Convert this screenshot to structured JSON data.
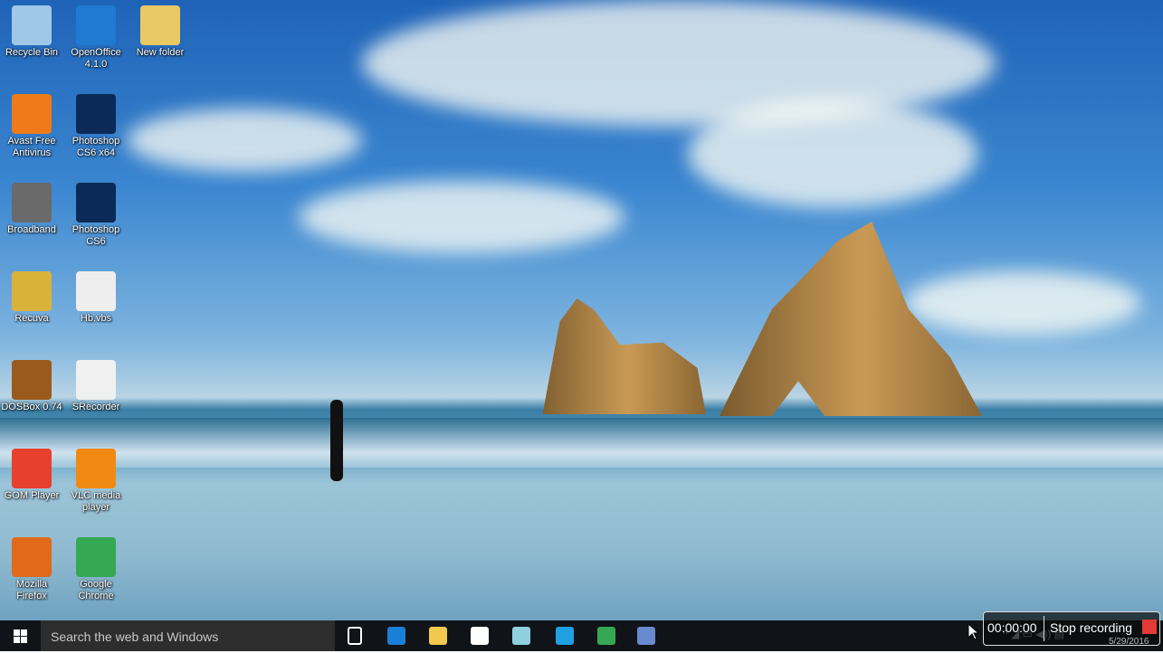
{
  "desktop": {
    "icons": [
      {
        "label": "Recycle Bin",
        "icon": "recycle-bin-icon",
        "color": "#9fc7e8"
      },
      {
        "label": "OpenOffice 4.1.0",
        "icon": "openoffice-icon",
        "color": "#1f7ad0"
      },
      {
        "label": "New folder",
        "icon": "folder-icon",
        "color": "#e8c964"
      },
      {
        "label": "Avast Free Antivirus",
        "icon": "avast-icon",
        "color": "#f07a1a"
      },
      {
        "label": "Photoshop CS6 x64",
        "icon": "photoshop-icon",
        "color": "#0b2a57"
      },
      {
        "label": "Broadband",
        "icon": "evo-icon",
        "color": "#6a6a6a"
      },
      {
        "label": "Photoshop CS6",
        "icon": "photoshop-icon",
        "color": "#0b2a57"
      },
      {
        "label": "Recuva",
        "icon": "recuva-icon",
        "color": "#d9b23a"
      },
      {
        "label": "Hb.vbs",
        "icon": "script-file-icon",
        "color": "#eeeeee"
      },
      {
        "label": "DOSBox 0.74",
        "icon": "dosbox-icon",
        "color": "#9a5a1e"
      },
      {
        "label": "SRecorder",
        "icon": "srecorder-icon",
        "color": "#f0f0f0"
      },
      {
        "label": "GOM Player",
        "icon": "gom-player-icon",
        "color": "#e8402e"
      },
      {
        "label": "VLC media player",
        "icon": "vlc-icon",
        "color": "#f08a12"
      },
      {
        "label": "Mozilla Firefox",
        "icon": "firefox-icon",
        "color": "#e06a1a"
      },
      {
        "label": "Google Chrome",
        "icon": "chrome-icon",
        "color": "#34a853"
      }
    ]
  },
  "taskbar": {
    "search_placeholder": "Search the web and Windows",
    "apps": [
      {
        "name": "task-view",
        "color": "#ffffff"
      },
      {
        "name": "edge",
        "color": "#1a7fd8"
      },
      {
        "name": "file-explorer",
        "color": "#f2c94c"
      },
      {
        "name": "store",
        "color": "#ffffff"
      },
      {
        "name": "notepad",
        "color": "#8fd0e0"
      },
      {
        "name": "skype",
        "color": "#1fa0e0"
      },
      {
        "name": "chrome",
        "color": "#34a853"
      },
      {
        "name": "network-app",
        "color": "#6a8ad0"
      }
    ]
  },
  "recorder": {
    "time": "00:00:00",
    "stop_label": "Stop recording",
    "stop_color": "#e53935"
  },
  "clock": {
    "date": "5/29/2016"
  }
}
